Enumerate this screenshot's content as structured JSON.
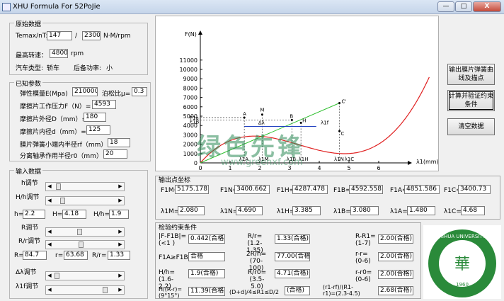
{
  "window": {
    "title": "XHU Formula  For 52PoJie",
    "min": "—",
    "max": "□",
    "close": "X"
  },
  "orig": {
    "legend": "原始数据",
    "temax_label": "Temax/nT:",
    "temax": "147",
    "slash": "/",
    "nT": "2300",
    "unit": "N·M/rpm",
    "maxspeed_label": "最高转速：",
    "maxspeed": "4800",
    "rpm": "rpm",
    "cartype_label": "汽车类型:",
    "cartype": "轿车",
    "power_label": "后备功率:",
    "power": "小"
  },
  "known": {
    "legend": "已知参数",
    "E_label": "弹性模量E(Mpa)",
    "E": "210000",
    "mu_label": "泊松比μ=",
    "mu": "0.3",
    "F_label": "摩擦片工作压力F（N）=",
    "F": "4593",
    "D_label": "摩擦片外径D（mm）=",
    "D": "180",
    "d_label": "摩擦片内径d（mm）=",
    "d": "125",
    "rf_label": "膜片弹簧小端内半径rf（mm）=",
    "rf": "18",
    "r0_label": "分离轴承作用半径r0（mm）=",
    "r0": "20"
  },
  "input": {
    "legend": "输入数据",
    "h_label": "h调节",
    "Hh_label": "H/h调节",
    "h_pre": "h=",
    "h": "2.2",
    "H_pre": "H=",
    "H": "4.18",
    "Hh_pre": "H/h=",
    "Hh": "1.9",
    "R_label": "R调节",
    "Rr_label": "R/r调节",
    "R_pre": "R=",
    "R": "84.7",
    "r_pre": "r=",
    "r": "63.68",
    "Rr_pre": "R/r=",
    "Rr": "1.33",
    "dl_label": "Δλ调节",
    "l1f_label": "λ1f调节"
  },
  "buttons": {
    "draw": "输出膜片弹簧曲线及描点",
    "verify": "计算并验证约束条件",
    "clear": "清空数据"
  },
  "chart_data": {
    "type": "line",
    "ylabel": "F(N)",
    "xlabel": "λ1(mm)",
    "yticks": [
      "11000",
      "10000",
      "9000",
      "8000",
      "7000",
      "6000",
      "5000",
      "4000",
      "3000",
      "2000",
      "1000",
      "0"
    ],
    "xticks": [
      "1",
      "2",
      "3",
      "4",
      "5",
      "6"
    ],
    "point_labels": [
      "A",
      "M",
      "B",
      "H",
      "C",
      "C'",
      "F1a",
      "F1B",
      "Δλ",
      "λ1f",
      "λ1A",
      "λ1M",
      "λ1B",
      "λ1H",
      "λ1N",
      "λ1C"
    ]
  },
  "output": {
    "legend": "输出点坐标",
    "F1M_l": "F1M=",
    "F1M": "5175.178",
    "F1N_l": "F1N=",
    "F1N": "3400.662",
    "F1H_l": "F1H=",
    "F1H": "4287.478",
    "F1B_l": "F1B=",
    "F1B": "4592.558",
    "F1A_l": "F1A=",
    "F1A": "4851.586",
    "F1C_l": "F1C=",
    "F1C": "3400.73",
    "l1M_l": "λ1M=",
    "l1M": "2.080",
    "l1N_l": "λ1N=",
    "l1N": "4.690",
    "l1H_l": "λ1H=",
    "l1H": "3.385",
    "l1B_l": "λ1B=",
    "l1B": "3.080",
    "l1A_l": "λ1A=",
    "l1A": "1.480",
    "l1C_l": "λ1C=",
    "l1C": "4.68"
  },
  "verify": {
    "legend": "检验约束条件",
    "c1_l": "|F-F1B|= (<1 )",
    "c1": "0.442(合格)",
    "c2_l": "R/r=(1.2-1.35)",
    "c2": "1.33(合格)",
    "c3_l": "R-R1=(1-7)",
    "c3": "2.00(合格)",
    "c4_l": "F1A≥F1B",
    "c4": "合格",
    "c5_l": "2R/h=(70-100)",
    "c5": "77.00(合格)",
    "c6_l": "r-r=(0-6)",
    "c6": "2.00(合格)",
    "c7_l": "H/h=(1.6-2.2)",
    "c7": "1.9(合格)",
    "c8_l": "R/r0=(3.5-5.0)",
    "c8": "4.71(合格)",
    "c9_l": "r-r0=(0-6)",
    "c9": "2.00(合格)",
    "c10_l": "H/(R-r)=(9°15°)",
    "c10": "11.39(合格)",
    "c11_l": "(D+d)/4≤R1≤D/2",
    "c11": "(合格)",
    "c12_l": "(r1-rf)/(R1-r1)=(2.3-4.5)",
    "c12": "2.68(合格)"
  },
  "watermark": {
    "main": "绿色先锋",
    "sub": "www.greenxf.com"
  },
  "logo": {
    "text": "XIHUA UNIVERSITY",
    "year": "1960"
  }
}
